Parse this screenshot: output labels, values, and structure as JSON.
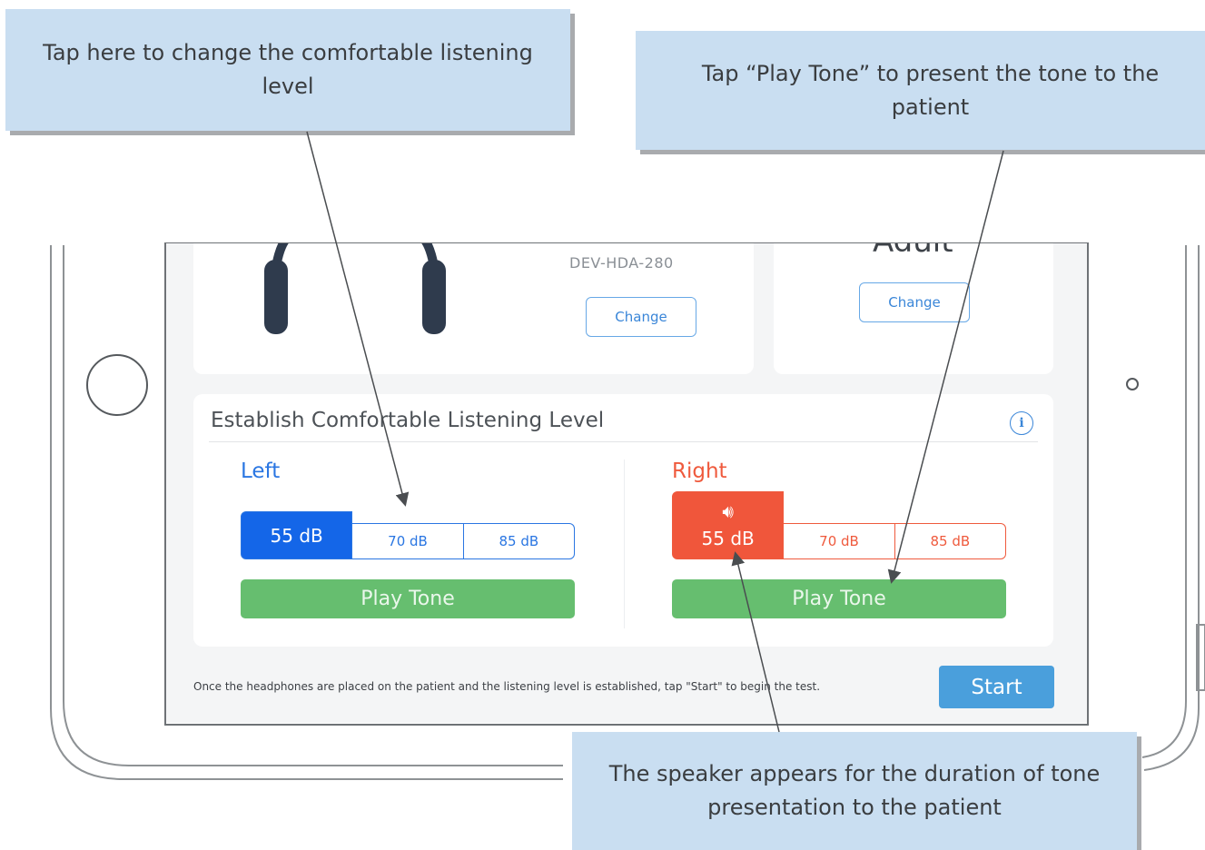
{
  "callouts": {
    "change_level": "Tap here to change the comfortable listening level",
    "play_tone": "Tap “Play Tone” to present the tone to the patient",
    "speaker": "The speaker appears for the duration of tone presentation to the patient"
  },
  "headphones": {
    "model": "DEV-HDA-280",
    "change_label": "Change"
  },
  "age_group": {
    "value": "Adult",
    "change_label": "Change"
  },
  "listening_level": {
    "title": "Establish Comfortable Listening Level",
    "info_icon": "i",
    "left": {
      "label": "Left",
      "options": [
        "55 dB",
        "70 dB",
        "85 dB"
      ],
      "selected": "55 dB",
      "play_label": "Play Tone"
    },
    "right": {
      "label": "Right",
      "options": [
        "55 dB",
        "70 dB",
        "85 dB"
      ],
      "selected": "55 dB",
      "speaker_icon": "speaker-icon",
      "play_label": "Play Tone"
    }
  },
  "footer": {
    "instruction": "Once the headphones are placed on the patient and the listening level is established, tap \"Start\" to begin the test.",
    "start_label": "Start"
  },
  "colors": {
    "left_accent": "#1466e8",
    "right_accent": "#f0563b",
    "play_green": "#66be6f",
    "start_blue": "#4a9fdc",
    "callout_bg": "#c9def1"
  }
}
